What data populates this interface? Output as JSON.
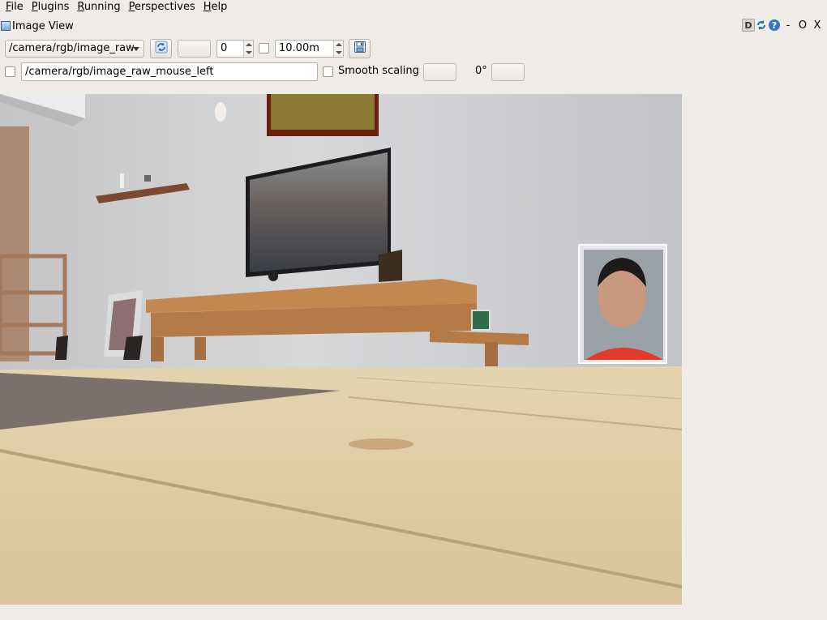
{
  "menu": {
    "items": [
      {
        "label_acc": "F",
        "label_rest": "ile"
      },
      {
        "label_acc": "P",
        "label_rest": "lugins"
      },
      {
        "label_acc": "R",
        "label_rest": "unning"
      },
      {
        "label_acc": "P",
        "label_rest": "erspectives"
      },
      {
        "label_acc": "H",
        "label_rest": "elp"
      }
    ]
  },
  "plugin": {
    "title": "Image View",
    "controls": {
      "d_label": "D",
      "help_label": "?",
      "minimize_label": "-",
      "float_label": "O",
      "close_label": "X"
    }
  },
  "toolbar": {
    "topic_selected": "/camera/rgb/image_raw",
    "spin_value": "0",
    "max_range_value": "10.00m",
    "publish_topic": "/camera/rgb/image_raw_mouse_left",
    "smooth_scaling_label": "Smooth scaling",
    "rotation_label": "0°"
  },
  "icons": {
    "refresh": "refresh-icon",
    "save": "save-image-icon",
    "plugin": "image-view-icon"
  },
  "colors": {
    "window_bg": "#efebe7",
    "accent_blue": "#3b73c4"
  }
}
